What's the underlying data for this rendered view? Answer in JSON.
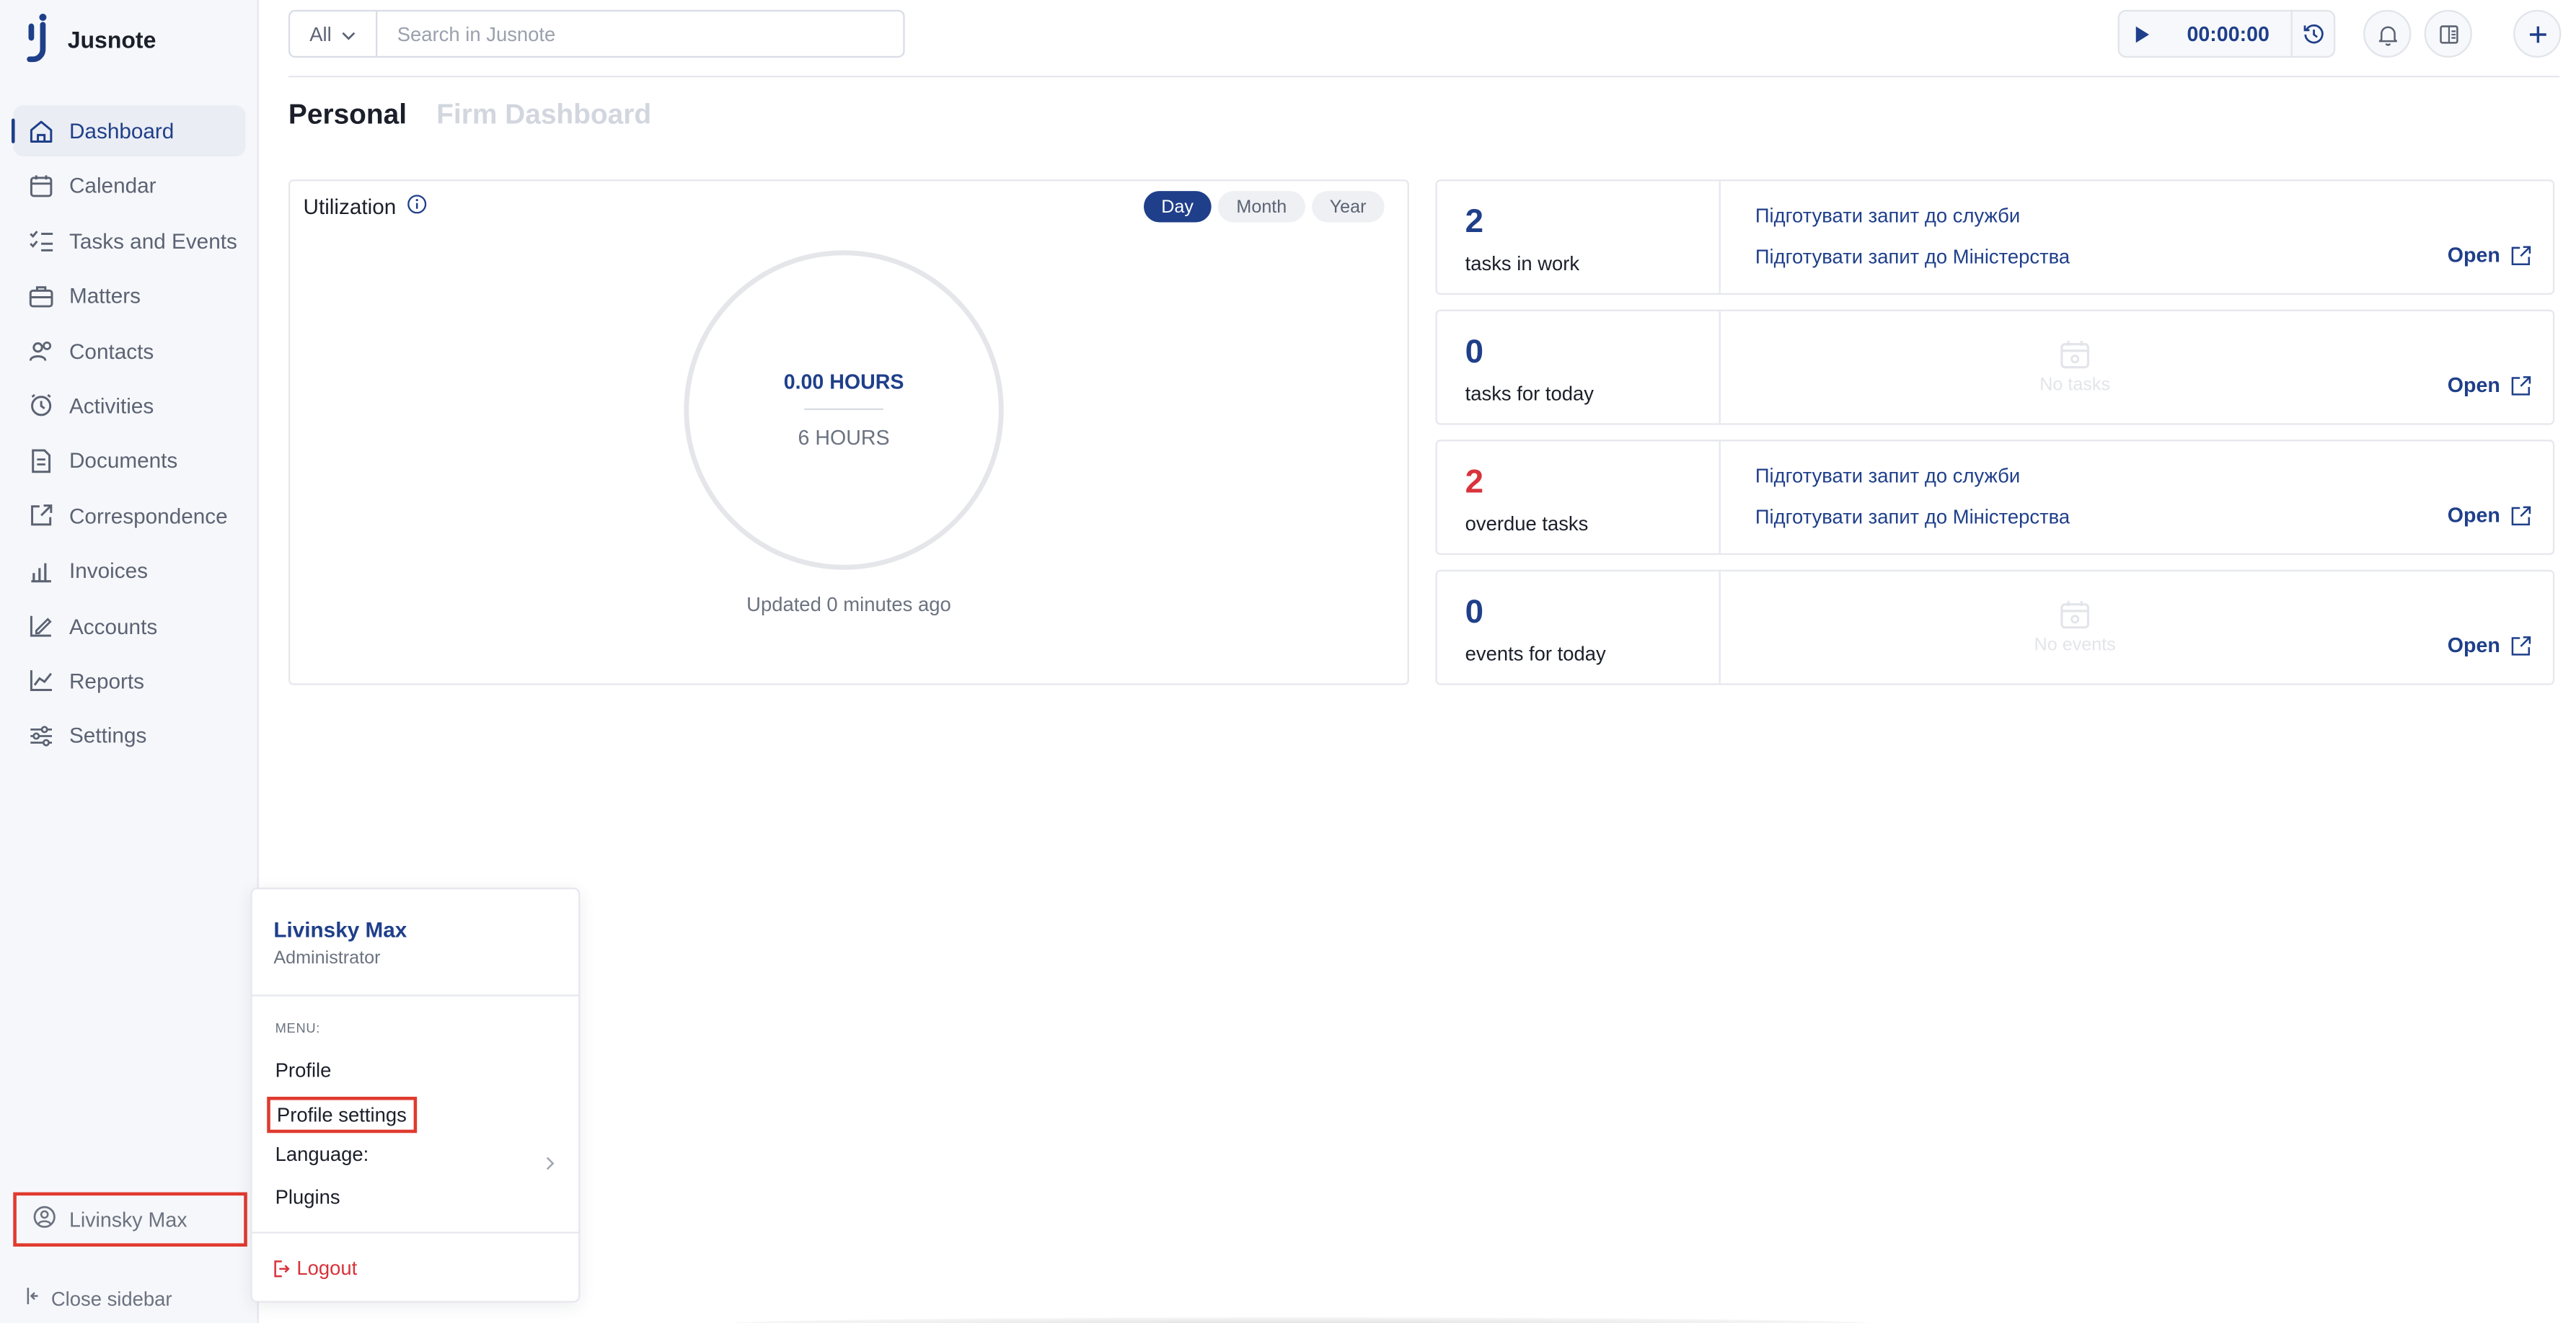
{
  "app": {
    "name": "Jusnote"
  },
  "sidebar": {
    "items": [
      {
        "label": "Dashboard",
        "icon": "home-icon",
        "active": true
      },
      {
        "label": "Calendar",
        "icon": "calendar-icon"
      },
      {
        "label": "Tasks and Events",
        "icon": "checklist-icon"
      },
      {
        "label": "Matters",
        "icon": "briefcase-icon"
      },
      {
        "label": "Contacts",
        "icon": "contacts-icon"
      },
      {
        "label": "Activities",
        "icon": "clock-icon"
      },
      {
        "label": "Documents",
        "icon": "document-icon"
      },
      {
        "label": "Correspondence",
        "icon": "correspondence-icon"
      },
      {
        "label": "Invoices",
        "icon": "invoice-icon"
      },
      {
        "label": "Accounts",
        "icon": "accounts-icon"
      },
      {
        "label": "Reports",
        "icon": "reports-icon"
      },
      {
        "label": "Settings",
        "icon": "settings-icon"
      }
    ],
    "user_name": "Livinsky Max",
    "close_label": "Close sidebar"
  },
  "topbar": {
    "search_filter": "All",
    "search_placeholder": "Search in Jusnote",
    "timer": "00:00:00"
  },
  "tabs": [
    {
      "label": "Personal",
      "active": true
    },
    {
      "label": "Firm Dashboard",
      "active": false
    }
  ],
  "utilization": {
    "title": "Utilization",
    "periods": [
      {
        "label": "Day",
        "active": true
      },
      {
        "label": "Month",
        "active": false
      },
      {
        "label": "Year",
        "active": false
      }
    ],
    "hours_value": "0.00 HOURS",
    "hours_total": "6 HOURS",
    "updated": "Updated 0 minutes ago"
  },
  "stats": [
    {
      "count": "2",
      "label": "tasks in work",
      "links": [
        "Підготувати запит до служби",
        "Підготувати запит до Міністерства"
      ],
      "empty": "",
      "open": "Open"
    },
    {
      "count": "0",
      "label": "tasks for today",
      "links": [],
      "empty": "No tasks",
      "open": "Open"
    },
    {
      "count": "2",
      "label": "overdue tasks",
      "links": [
        "Підготувати запит до служби",
        "Підготувати запит до Міністерства"
      ],
      "empty": "",
      "open": "Open"
    },
    {
      "count": "0",
      "label": "events for today",
      "links": [],
      "empty": "No events",
      "open": "Open"
    }
  ],
  "user_menu": {
    "name": "Livinsky Max",
    "role": "Administrator",
    "caption": "MENU:",
    "items": [
      "Profile",
      "Profile settings",
      "Language:",
      "Plugins"
    ],
    "logout": "Logout"
  },
  "colors": {
    "accent": "#1f3f8a",
    "danger": "#d8333b",
    "highlight": "#e03a2f"
  }
}
